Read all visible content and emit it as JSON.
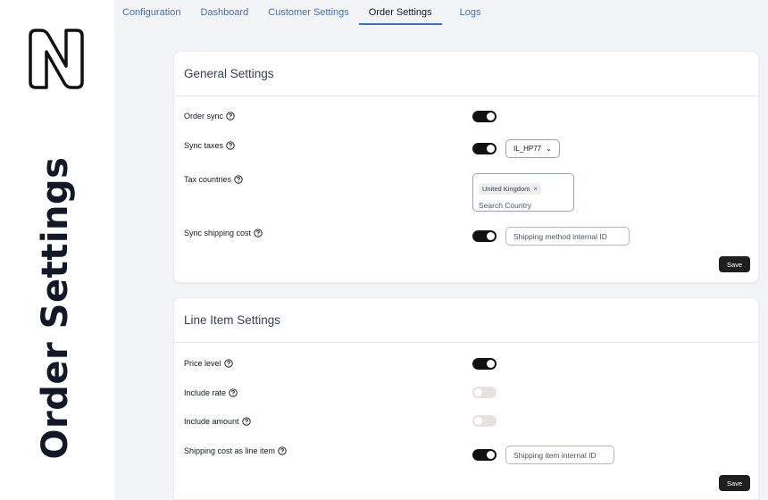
{
  "page": {
    "vertical_title": "Order Settings"
  },
  "tabs": [
    {
      "label": "Configuration",
      "active": false
    },
    {
      "label": "Dashboard",
      "active": false
    },
    {
      "label": "Customer Settings",
      "active": false
    },
    {
      "label": "Order Settings",
      "active": true
    },
    {
      "label": "Logs",
      "active": false
    }
  ],
  "general": {
    "title": "General Settings",
    "order_sync": {
      "label": "Order sync",
      "enabled": true
    },
    "sync_taxes": {
      "label": "Sync taxes",
      "enabled": true,
      "select_value": "IL_HP77"
    },
    "tax_countries": {
      "label": "Tax countries",
      "chips": [
        "United Kingdom"
      ],
      "search_placeholder": "Search Country"
    },
    "sync_shipping_cost": {
      "label": "Sync shipping cost",
      "enabled": true,
      "input_placeholder": "Shipping method internal ID"
    },
    "save_label": "Save"
  },
  "line_items": {
    "title": "Line Item Settings",
    "price_level": {
      "label": "Price level",
      "enabled": true
    },
    "include_rate": {
      "label": "Include rate",
      "enabled": false
    },
    "include_amount": {
      "label": "Include amount",
      "enabled": false
    },
    "shipping_cost_line_item": {
      "label": "Shipping cost as line item",
      "enabled": true,
      "input_placeholder": "Shipping item internal ID"
    },
    "save_label": "Save"
  },
  "colors": {
    "accent": "#3b6fc8",
    "toggle_on": "#111111",
    "toggle_off": "#e5e1e1",
    "background": "#f3f4f6"
  }
}
